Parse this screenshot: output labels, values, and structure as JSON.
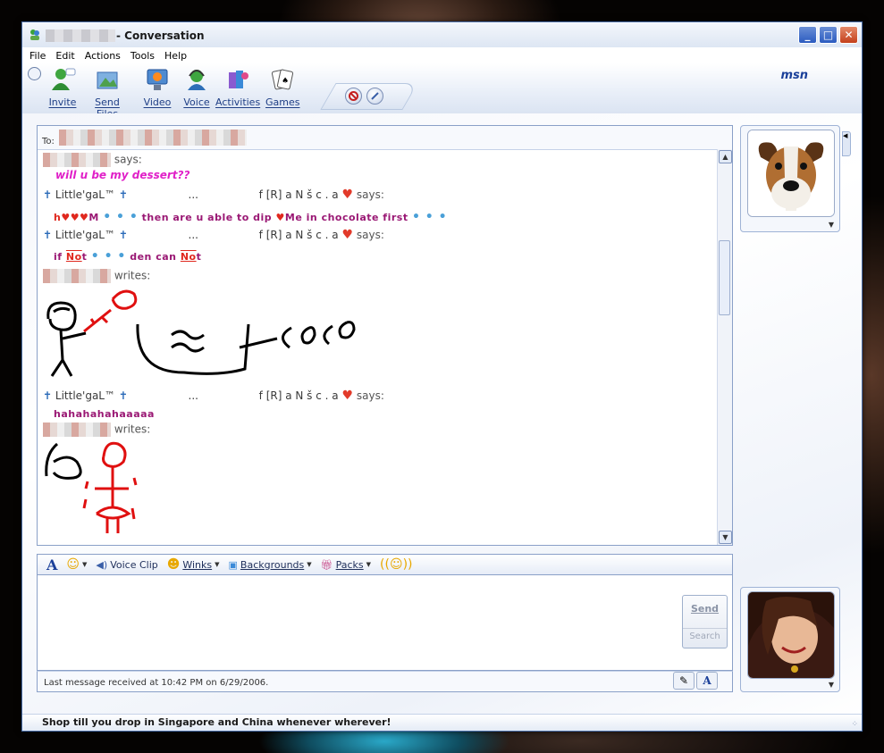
{
  "window": {
    "title": "- Conversation",
    "controls": {
      "minimize": "_",
      "maximize": "□",
      "close": "✕"
    }
  },
  "menu": [
    "File",
    "Edit",
    "Actions",
    "Tools",
    "Help"
  ],
  "toolbar": {
    "buttons": [
      "Invite",
      "Send Files",
      "Video",
      "Voice",
      "Activities",
      "Games"
    ],
    "brand": "msn"
  },
  "conversation": {
    "to_label": "To:",
    "messages": [
      {
        "says": "says:",
        "text": "will u be my dessert??"
      },
      {
        "sender": "Little'gaL™",
        "sep": "...",
        "name2": "f [R] a N š c . a",
        "says": "says:",
        "text_a": "M",
        "text_b": "then are u able to dip",
        "text_c": "Me in chocolate first"
      },
      {
        "sender": "Little'gaL™",
        "sep": "...",
        "name2": "f [R] a N š c . a",
        "says": "says:",
        "text_a": "if",
        "text_b": "No",
        "text_c": "t",
        "text_d": "den can",
        "text_e": "No",
        "text_f": "t"
      },
      {
        "writes": "writes:"
      },
      {
        "sender": "Little'gaL™",
        "sep": "...",
        "name2": "f [R] a N š c . a",
        "says": "says:",
        "text": "hahahahahaaaaa"
      },
      {
        "writes": "writes:"
      }
    ]
  },
  "format_bar": {
    "voice_clip": "Voice Clip",
    "winks": "Winks",
    "backgrounds": "Backgrounds",
    "packs": "Packs"
  },
  "send": {
    "send_label": "Send",
    "search_label": "Search"
  },
  "status": {
    "text": "Last message received at 10:42 PM on 6/29/2006."
  },
  "ad": {
    "text": "Shop till you drop in Singapore and China whenever wherever!"
  },
  "colors": {
    "pink_text": "#e020c8",
    "purple_text": "#9a1874",
    "window_border": "#4a6ea8",
    "accent_blue": "#1f3f86"
  }
}
